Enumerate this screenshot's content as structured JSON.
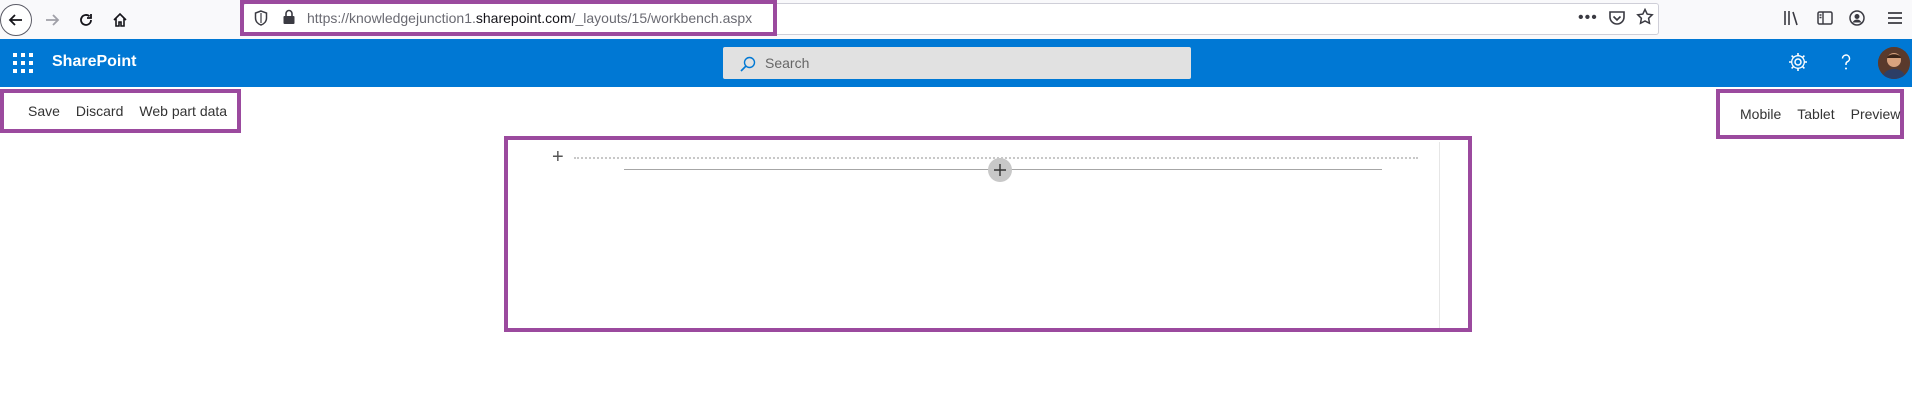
{
  "browser": {
    "url_prefix": "https://knowledgejunction1.",
    "url_domain": "sharepoint.com",
    "url_path": "/_layouts/15/workbench.aspx"
  },
  "suite": {
    "brand": "SharePoint",
    "search_placeholder": "Search"
  },
  "command_bar": {
    "left": [
      "Save",
      "Discard",
      "Web part data"
    ],
    "right": [
      "Mobile",
      "Tablet",
      "Preview"
    ]
  },
  "colors": {
    "suite_bar": "#0078d4",
    "highlight_border": "#9b4a9e"
  },
  "icons": [
    "back-icon",
    "forward-icon",
    "reload-icon",
    "home-icon",
    "shield-icon",
    "lock-icon",
    "more-icon",
    "pocket-icon",
    "star-icon",
    "library-icon",
    "sidebar-icon",
    "account-icon",
    "menu-icon",
    "waffle-icon",
    "search-icon",
    "settings-icon",
    "help-icon",
    "add-section-icon",
    "add-webpart-icon"
  ]
}
